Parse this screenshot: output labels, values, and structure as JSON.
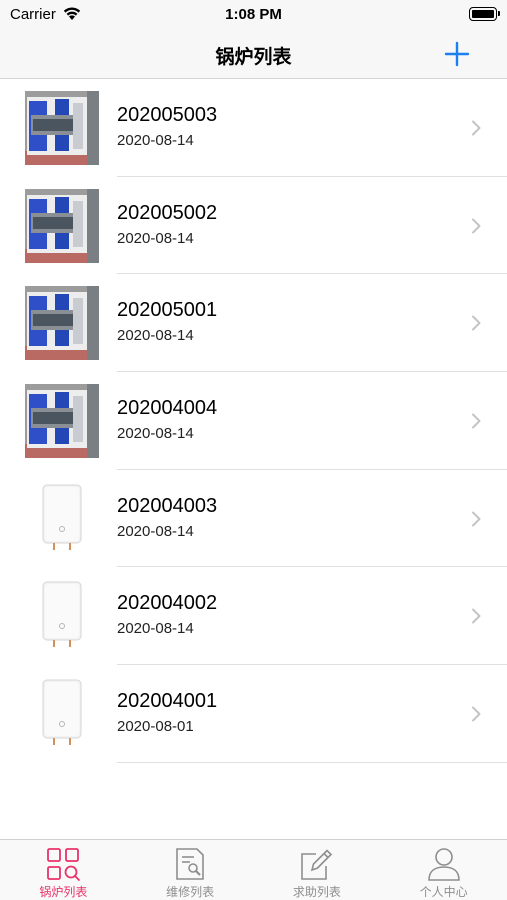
{
  "status_bar": {
    "carrier": "Carrier",
    "time": "1:08 PM"
  },
  "nav": {
    "title": "锅炉列表",
    "add_icon": "plus-icon"
  },
  "boilers": [
    {
      "id": "202005003",
      "date": "2020-08-14",
      "thumb": "blue-boiler"
    },
    {
      "id": "202005002",
      "date": "2020-08-14",
      "thumb": "blue-boiler"
    },
    {
      "id": "202005001",
      "date": "2020-08-14",
      "thumb": "blue-boiler"
    },
    {
      "id": "202004004",
      "date": "2020-08-14",
      "thumb": "blue-boiler"
    },
    {
      "id": "202004003",
      "date": "2020-08-14",
      "thumb": "white-boiler"
    },
    {
      "id": "202004002",
      "date": "2020-08-14",
      "thumb": "white-boiler"
    },
    {
      "id": "202004001",
      "date": "2020-08-01",
      "thumb": "white-boiler"
    }
  ],
  "tabs": [
    {
      "label": "锅炉列表",
      "icon": "grid-search-icon",
      "active": true
    },
    {
      "label": "维修列表",
      "icon": "document-wrench-icon",
      "active": false
    },
    {
      "label": "求助列表",
      "icon": "edit-icon",
      "active": false
    },
    {
      "label": "个人中心",
      "icon": "person-icon",
      "active": false
    }
  ],
  "colors": {
    "accent": "#1a7ff0",
    "active_tab": "#e8336b",
    "inactive_tab": "#8e8e8e"
  }
}
